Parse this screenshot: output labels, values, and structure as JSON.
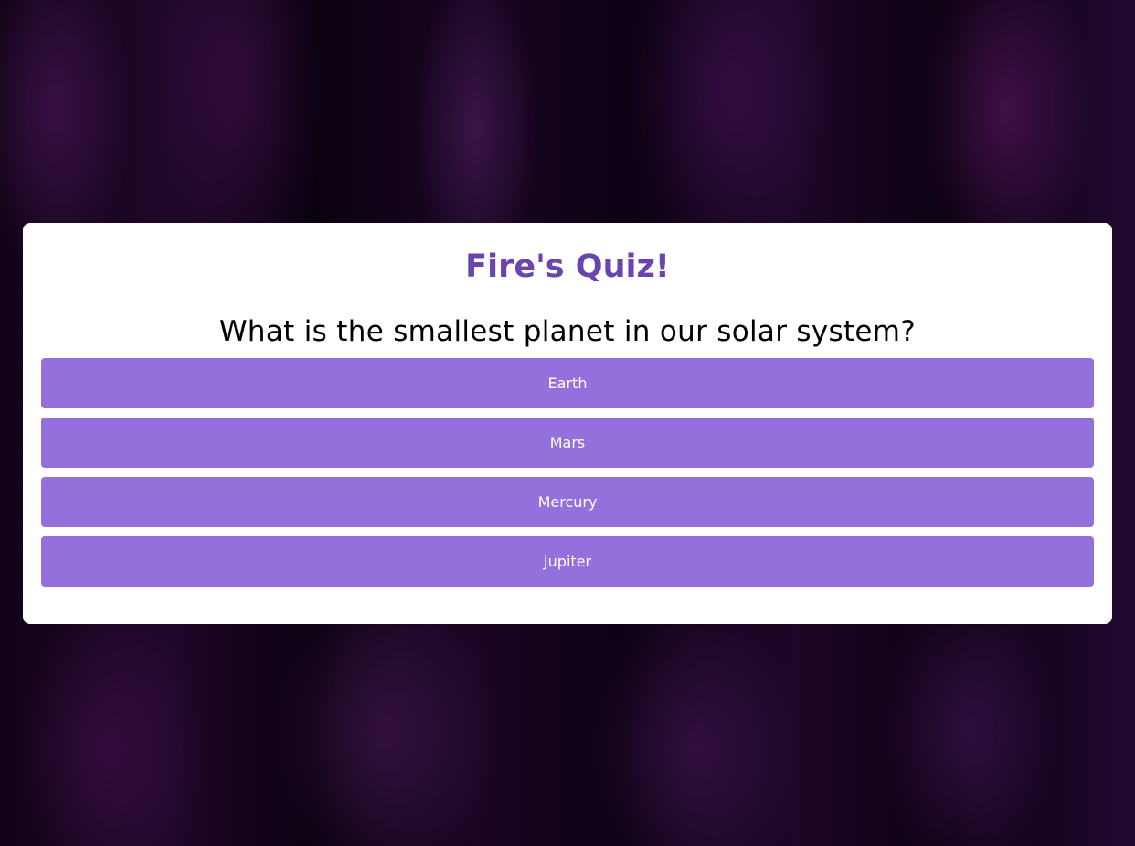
{
  "quiz": {
    "title": "Fire's Quiz!",
    "question": "What is the smallest planet in our solar system?",
    "answers": [
      {
        "label": "Earth"
      },
      {
        "label": "Mars"
      },
      {
        "label": "Mercury"
      },
      {
        "label": "Jupiter"
      }
    ]
  },
  "colors": {
    "title": "#6c44b0",
    "button_bg": "#9370db",
    "button_text": "#ffffff",
    "card_bg": "#ffffff",
    "background": "#0b0212"
  }
}
